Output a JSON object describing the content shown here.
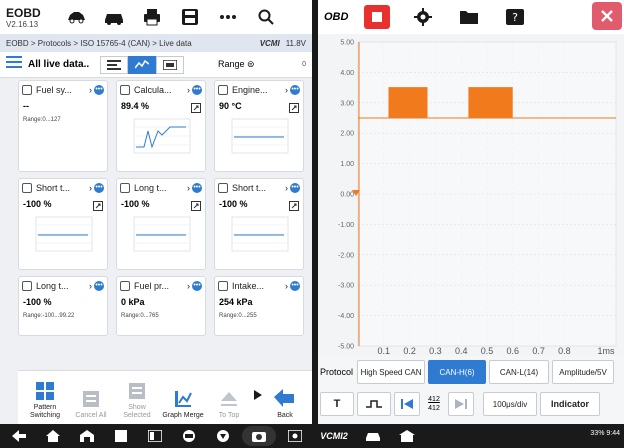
{
  "app": {
    "name": "EOBD",
    "version": "V2.16.13"
  },
  "breadcrumb": "EOBD > Protocols > ISO 15765-4 (CAN) > Live data",
  "status": {
    "vci": "VCMI",
    "voltage": "11.8V"
  },
  "toolbar": {
    "title": "All live data..",
    "range_label": "Range",
    "zero": "0"
  },
  "cards": [
    {
      "name": "Fuel sy...",
      "value": "--",
      "range": "Range:0...127",
      "graph": false
    },
    {
      "name": "Calcula...",
      "value": "89.4 %",
      "range": "",
      "graph": true
    },
    {
      "name": "Engine...",
      "value": "90 °C",
      "range": "",
      "graph": true
    },
    {
      "name": "Short t...",
      "value": "-100 %",
      "range": "",
      "graph": true
    },
    {
      "name": "Long t...",
      "value": "-100 %",
      "range": "",
      "graph": true
    },
    {
      "name": "Short t...",
      "value": "-100 %",
      "range": "",
      "graph": true
    },
    {
      "name": "Long t...",
      "value": "-100 %",
      "range": "Range:-100...99.22",
      "graph": false
    },
    {
      "name": "Fuel pr...",
      "value": "0 kPa",
      "range": "Range:0...765",
      "graph": false
    },
    {
      "name": "Intake...",
      "value": "254 kPa",
      "range": "Range:0...255",
      "graph": false
    }
  ],
  "bottombar": [
    {
      "label": "Pattern Switching",
      "enabled": true
    },
    {
      "label": "Cancel All",
      "enabled": false
    },
    {
      "label": "Show Selected",
      "enabled": false
    },
    {
      "label": "Graph Merge",
      "enabled": true
    },
    {
      "label": "To Top",
      "enabled": false
    },
    {
      "label": "Back",
      "enabled": true
    }
  ],
  "scope": {
    "header": "OBD",
    "controls": {
      "protocol_label": "Protocol",
      "protocol_value": "High Speed CAN",
      "can_h": "CAN-H(6)",
      "can_l": "CAN-L(14)",
      "amplitude": "Amplitude/5V",
      "t_label": "T",
      "page_top": "412",
      "page_bottom": "412",
      "timebase": "100μs/div",
      "indicator": "Indicator"
    }
  },
  "chart_data": {
    "type": "line",
    "title": "",
    "xlabel": "",
    "ylabel": "",
    "x_ticks": [
      "0.1",
      "0.2",
      "0.3",
      "0.4",
      "0.5",
      "0.6",
      "0.7",
      "0.8",
      "1ms"
    ],
    "y_ticks": [
      "5.00",
      "4.00",
      "3.00",
      "2.00",
      "1.00",
      "0.00",
      "-1.00",
      "-2.00",
      "-3.00",
      "-4.00",
      "-5.00"
    ],
    "ylim": [
      -5,
      5
    ],
    "xlim": [
      0,
      1
    ],
    "series": [
      {
        "color": "#f07a1c",
        "baseline": 2.5,
        "high": 3.5,
        "bursts": [
          [
            0.12,
            0.27
          ],
          [
            0.43,
            0.6
          ]
        ]
      }
    ]
  },
  "nav": {
    "vci": "VCMI2",
    "status": "33% 9:44"
  },
  "colors": {
    "accent": "#2e7bd1",
    "stop": "#e8312f",
    "trace": "#f07a1c"
  }
}
